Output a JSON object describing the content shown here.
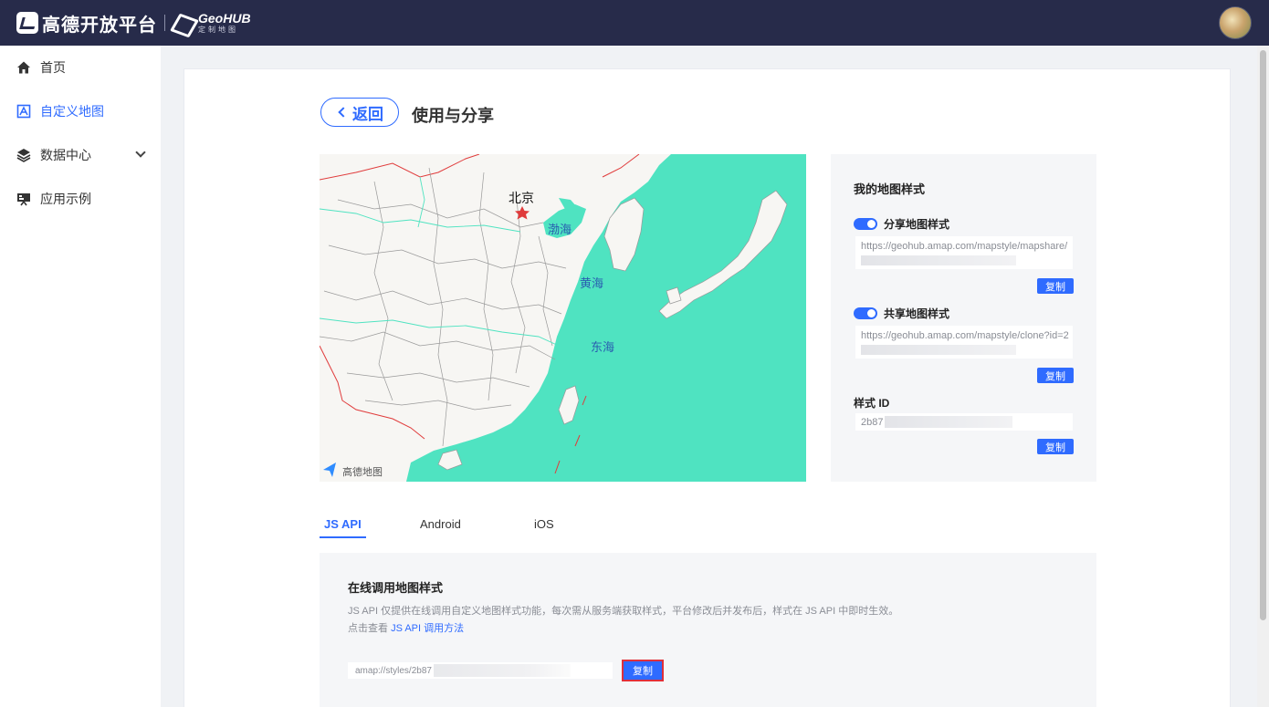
{
  "header": {
    "brand": "高德开放平台",
    "product": "GeoHUB",
    "product_sub": "定制地图"
  },
  "sidebar": {
    "items": [
      {
        "label": "首页",
        "icon": "home-icon"
      },
      {
        "label": "自定义地图",
        "icon": "custom-map-icon",
        "active": true
      },
      {
        "label": "数据中心",
        "icon": "layers-icon",
        "expandable": true
      },
      {
        "label": "应用示例",
        "icon": "monitor-icon"
      }
    ]
  },
  "page": {
    "back_label": "返回",
    "title": "使用与分享"
  },
  "map": {
    "city": "北京",
    "seas": [
      "渤海",
      "黄海",
      "东海"
    ],
    "watermark": "高德地图",
    "colors": {
      "sea": "#4fe3c1",
      "land": "#f7f6f3",
      "border": "#e03b3b",
      "province": "#888888",
      "river": "#4fe3c1"
    }
  },
  "style_panel": {
    "title": "我的地图样式",
    "share": {
      "label": "分享地图样式",
      "url": "https://geohub.amap.com/mapstyle/mapshare/",
      "copy": "复制"
    },
    "clone": {
      "label": "共享地图样式",
      "url": "https://geohub.amap.com/mapstyle/clone?id=2",
      "copy": "复制"
    },
    "style_id": {
      "label": "样式 ID",
      "value": "2b87",
      "copy": "复制"
    }
  },
  "tabs": [
    "JS API",
    "Android",
    "iOS"
  ],
  "code_section": {
    "title": "在线调用地图样式",
    "desc": "JS API 仅提供在线调用自定义地图样式功能，每次需从服务端获取样式，平台修改后并发布后，样式在 JS API 中即时生效。",
    "link_prefix": "点击查看",
    "link_text": "JS API 调用方法",
    "value": "amap://styles/2b87",
    "copy": "复制"
  },
  "accent": "#2f6bff"
}
